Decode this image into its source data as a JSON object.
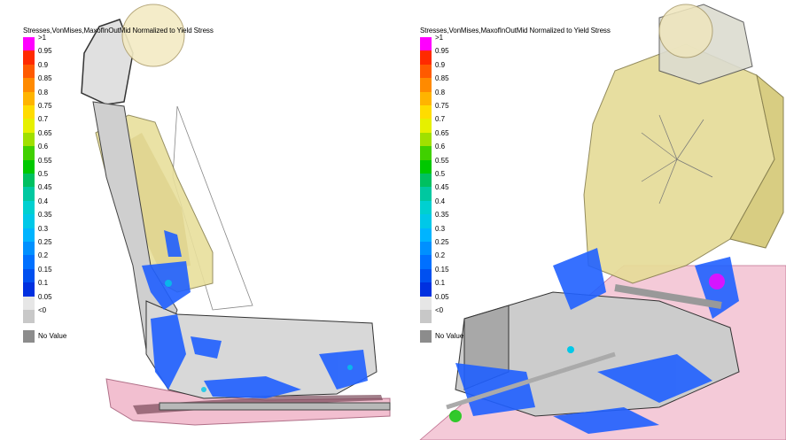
{
  "legend": {
    "title": "Stresses,VonMises,MaxofInOutMid Normalized to Yield Stress",
    "labels": [
      ">1",
      "0.95",
      "0.9",
      "0.85",
      "0.8",
      "0.75",
      "0.7",
      "0.65",
      "0.6",
      "0.55",
      "0.5",
      "0.45",
      "0.4",
      "0.35",
      "0.3",
      "0.25",
      "0.2",
      "0.15",
      "0.1",
      "0.05",
      "<0"
    ],
    "colors": [
      "#ff00ff",
      "#ff2a00",
      "#ff5a00",
      "#ff8a00",
      "#ffb400",
      "#ffdc00",
      "#e6f000",
      "#a0e000",
      "#40d000",
      "#00c800",
      "#00c060",
      "#00c8a0",
      "#00d0d0",
      "#00c8e8",
      "#00b4ff",
      "#0090ff",
      "#0070ff",
      "#0050f0",
      "#0030e0",
      "#e6e6e6",
      "#c8c8c8"
    ],
    "no_value_label": "No Value",
    "no_value_color": "#8c8c8c"
  },
  "colors": {
    "background": "#ffffff",
    "seat_back_fill": "#e8e0a0",
    "headrest": "#f0e8b8",
    "frame_metal": "#c8c8c8",
    "floor_pan": "#f4c8d8",
    "stress_blue": "#2060ff"
  }
}
